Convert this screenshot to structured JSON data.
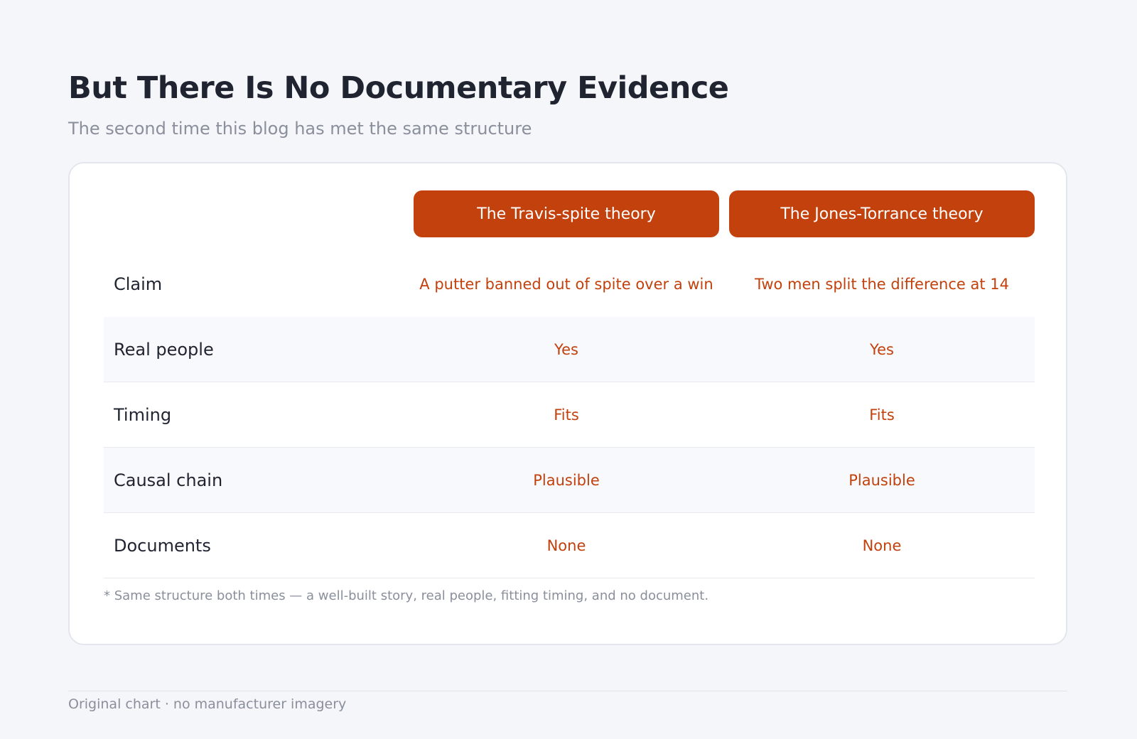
{
  "title": "But There Is No Documentary Evidence",
  "subtitle": "The second time this blog has met the same structure",
  "table": {
    "columns": [
      "The Travis-spite theory",
      "The Jones-Torrance theory"
    ],
    "rows": [
      {
        "label": "Claim",
        "values": [
          "A putter banned out of spite over a win",
          "Two men split the difference at 14"
        ]
      },
      {
        "label": "Real people",
        "values": [
          "Yes",
          "Yes"
        ]
      },
      {
        "label": "Timing",
        "values": [
          "Fits",
          "Fits"
        ]
      },
      {
        "label": "Causal chain",
        "values": [
          "Plausible",
          "Plausible"
        ]
      },
      {
        "label": "Documents",
        "values": [
          "None",
          "None"
        ]
      }
    ]
  },
  "footnote": "* Same structure both times — a well-built story, real people, fitting timing, and no document.",
  "footer": "Original chart · no manufacturer imagery",
  "colors": {
    "accent": "#c2410c",
    "background": "#f5f6fa",
    "card": "#ffffff",
    "muted_text": "#8a8f9c"
  }
}
